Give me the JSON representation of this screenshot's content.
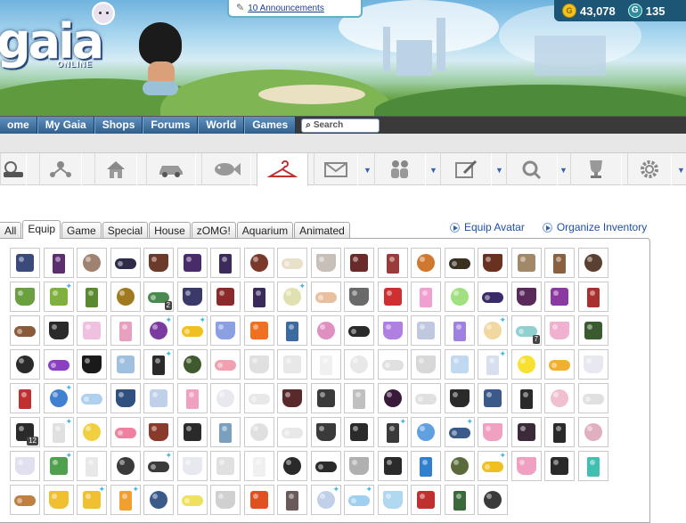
{
  "header": {
    "logo_text": "gaia",
    "logo_subtext": "ONLINE",
    "announcements_link": "10 Announcements",
    "gold_amount": "43,078",
    "gold_icon": "gold-coin-icon",
    "gcash_amount": "135",
    "gcash_icon": "gcash-icon"
  },
  "main_nav": {
    "items": [
      {
        "label": "ome"
      },
      {
        "label": "My Gaia"
      },
      {
        "label": "Shops"
      },
      {
        "label": "Forums"
      },
      {
        "label": "World"
      },
      {
        "label": "Games"
      }
    ],
    "search_placeholder": "Search"
  },
  "toolbar": {
    "icons": [
      {
        "name": "gaia-home-icon",
        "dropdown": false
      },
      {
        "name": "friends-network-icon",
        "dropdown": false
      },
      {
        "name": "house-icon",
        "dropdown": false
      },
      {
        "name": "car-icon",
        "dropdown": false
      },
      {
        "name": "fish-aquarium-icon",
        "dropdown": false
      },
      {
        "name": "hanger-icon",
        "dropdown": false,
        "active": true
      },
      {
        "name": "mail-icon",
        "dropdown": true
      },
      {
        "name": "people-icon",
        "dropdown": true
      },
      {
        "name": "journal-pen-icon",
        "dropdown": true
      },
      {
        "name": "search-quest-icon",
        "dropdown": true
      },
      {
        "name": "trophy-icon",
        "dropdown": false
      },
      {
        "name": "settings-gear-icon",
        "dropdown": true
      }
    ]
  },
  "inventory": {
    "tabs": [
      {
        "label": "All"
      },
      {
        "label": "Equip",
        "active": true
      },
      {
        "label": "Game"
      },
      {
        "label": "Special"
      },
      {
        "label": "House"
      },
      {
        "label": "zOMG!"
      },
      {
        "label": "Aquarium"
      },
      {
        "label": "Animated"
      }
    ],
    "links": [
      {
        "label": "Equip Avatar"
      },
      {
        "label": "Organize Inventory"
      }
    ],
    "items": [
      [
        "#3a4a7a",
        "#5b2f6e",
        "#a08270",
        "#2e2b4a",
        "#6b3a2a",
        "#4a2b6a",
        "#3b2a5a",
        "#7a3a2a",
        "#e8e0c8",
        "#c8c0b8",
        "#6a2a2a",
        "#9a3a3a",
        "#d07830",
        "#3a3020",
        "#6a3020",
        "#a08868",
        "#8a6040",
        "#5a4030"
      ],
      [
        "#6aa040",
        "#80b040",
        "#5a8a30",
        "#a07a20",
        "#4a8a50",
        "#3a3a6a",
        "#8a2a2a",
        "#3a2a5a",
        "#e0e0b0",
        "#e8c0a0",
        "#6a6a6a",
        "#cc3030",
        "#f0a0d0",
        "#a0e080",
        "#3a2a6a",
        "#5a2a5a",
        "#8a3aa0",
        "#aa3030"
      ],
      [
        "#8a5a3a",
        "#2a2a2a",
        "#f0c0e0",
        "#e8a0c0",
        "#7a3aa0",
        "#f0c020",
        "#8aa0e0",
        "#f07020",
        "#3a6aa0",
        "#e090c0",
        "#2a2a2a",
        "#b080e0",
        "#c0c8e0",
        "#a080e0",
        "#f0d8a0",
        "#90d0d0",
        "#f0b0d0",
        "#3a5a30"
      ],
      [
        "#2a2a2a",
        "#8a40c0",
        "#1a1a1a",
        "#a0c0e0",
        "#2a2a2a",
        "#405a30",
        "#f0a0b0",
        "#e0e0e0",
        "#e8e8e8",
        "#f0f0f0",
        "#e8e8e8",
        "#e0e0e0",
        "#d8d8d8",
        "#c0d8f0",
        "#d8e0f0",
        "#f8e030",
        "#f0b030",
        "#e8e8f0"
      ],
      [
        "#c03030",
        "#4080d0",
        "#b0d0f0",
        "#305080",
        "#c0d0e8",
        "#f0a0c0",
        "#e8e8f0",
        "#e8e8e8",
        "#5a2a2a",
        "#3a3a3a",
        "#c0c0c0",
        "#3a1a3a",
        "#e0e0e0",
        "#2a2a2a",
        "#3a5a8a",
        "#2a2a2a",
        "#f0c0d0",
        "#e0e0e0"
      ],
      [
        "#2a2a2a",
        "#e0e0e0",
        "#f0d040",
        "#f080a0",
        "#8a3a2a",
        "#2a2a2a",
        "#7aa0c0",
        "#e0e0e0",
        "#e8e8e8",
        "#3a3a3a",
        "#2a2a2a",
        "#3a3a3a",
        "#60a0e0",
        "#3a5a8a",
        "#f0a0c0",
        "#3a2a3a",
        "#2a2a2a",
        "#e0b0c0"
      ],
      [
        "#e0e0f0",
        "#50a050",
        "#e8e8e8",
        "#3a3a3a",
        "#3a3a3a",
        "#e8e8f0",
        "#e0e0e0",
        "#f0f0f0",
        "#2a2a2a",
        "#2a2a2a",
        "#b0b0b0",
        "#2a2a2a",
        "#3080d0",
        "#5a6a3a",
        "#f0c020",
        "#f0a0c0",
        "#2a2a2a",
        "#40c0b0"
      ],
      [
        "#c08040",
        "#f0c030",
        "#f0c030",
        "#f0a030",
        "#3a5a8a",
        "#f0e060",
        "#d0d0d0",
        "#e05020",
        "#6a5a5a",
        "#c0d0e8",
        "#a0d0f0",
        "#b0d8f0",
        "#c03030",
        "#3a6a3a",
        "#3a3a3a"
      ]
    ],
    "badges": [
      {
        "row": 1,
        "col": 4,
        "count": "2"
      },
      {
        "row": 2,
        "col": 15,
        "count": "7"
      },
      {
        "row": 5,
        "col": 0,
        "count": "12"
      }
    ]
  }
}
